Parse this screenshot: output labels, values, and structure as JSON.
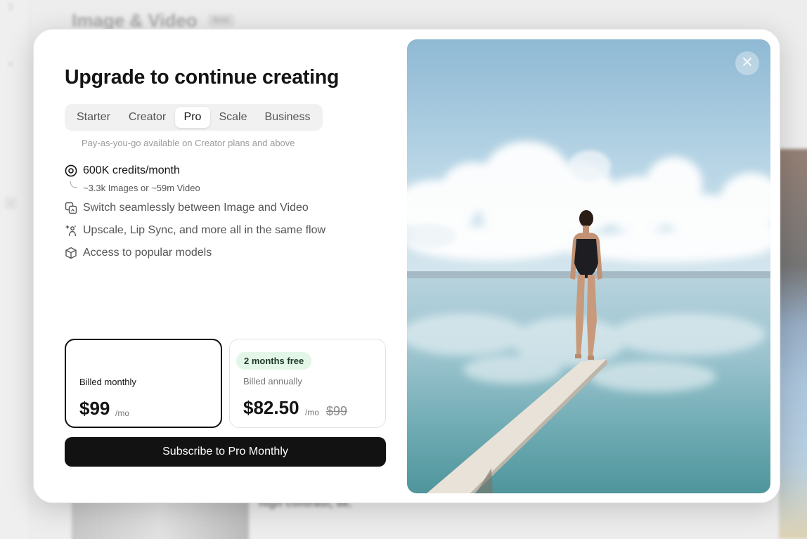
{
  "background": {
    "page_title": "Image & Video",
    "badge": "Beta",
    "caption": "high contrast, 8k."
  },
  "modal": {
    "title": "Upgrade to continue creating",
    "tabs": [
      {
        "label": "Starter",
        "active": false
      },
      {
        "label": "Creator",
        "active": false
      },
      {
        "label": "Pro",
        "active": true
      },
      {
        "label": "Scale",
        "active": false
      },
      {
        "label": "Business",
        "active": false
      }
    ],
    "payg_note": "Pay-as-you-go available on Creator plans and above",
    "features": {
      "credits": {
        "label": "600K credits/month",
        "icon": "coin-icon",
        "sub": "~3.3k Images or ~59m Video"
      },
      "switch": {
        "label": "Switch seamlessly between Image and Video",
        "icon": "media-switch-icon"
      },
      "upscale": {
        "label": "Upscale, Lip Sync, and more all in the same flow",
        "icon": "sparkle-person-icon"
      },
      "models": {
        "label": "Access to popular models",
        "icon": "cube-icon"
      }
    },
    "plans": {
      "monthly": {
        "billed": "Billed monthly",
        "price": "$99",
        "per": "/mo",
        "selected": true
      },
      "annual": {
        "badge": "2 months free",
        "billed": "Billed annually",
        "price": "$82.50",
        "per": "/mo",
        "original": "$99",
        "selected": false
      }
    },
    "cta": "Subscribe to Pro Monthly",
    "close_icon": "close-icon"
  },
  "colors": {
    "cta_bg": "#121212",
    "badge_green_bg": "#e3f6e8",
    "sky_top": "#8fb9d4",
    "water": "#5e9fa8"
  }
}
